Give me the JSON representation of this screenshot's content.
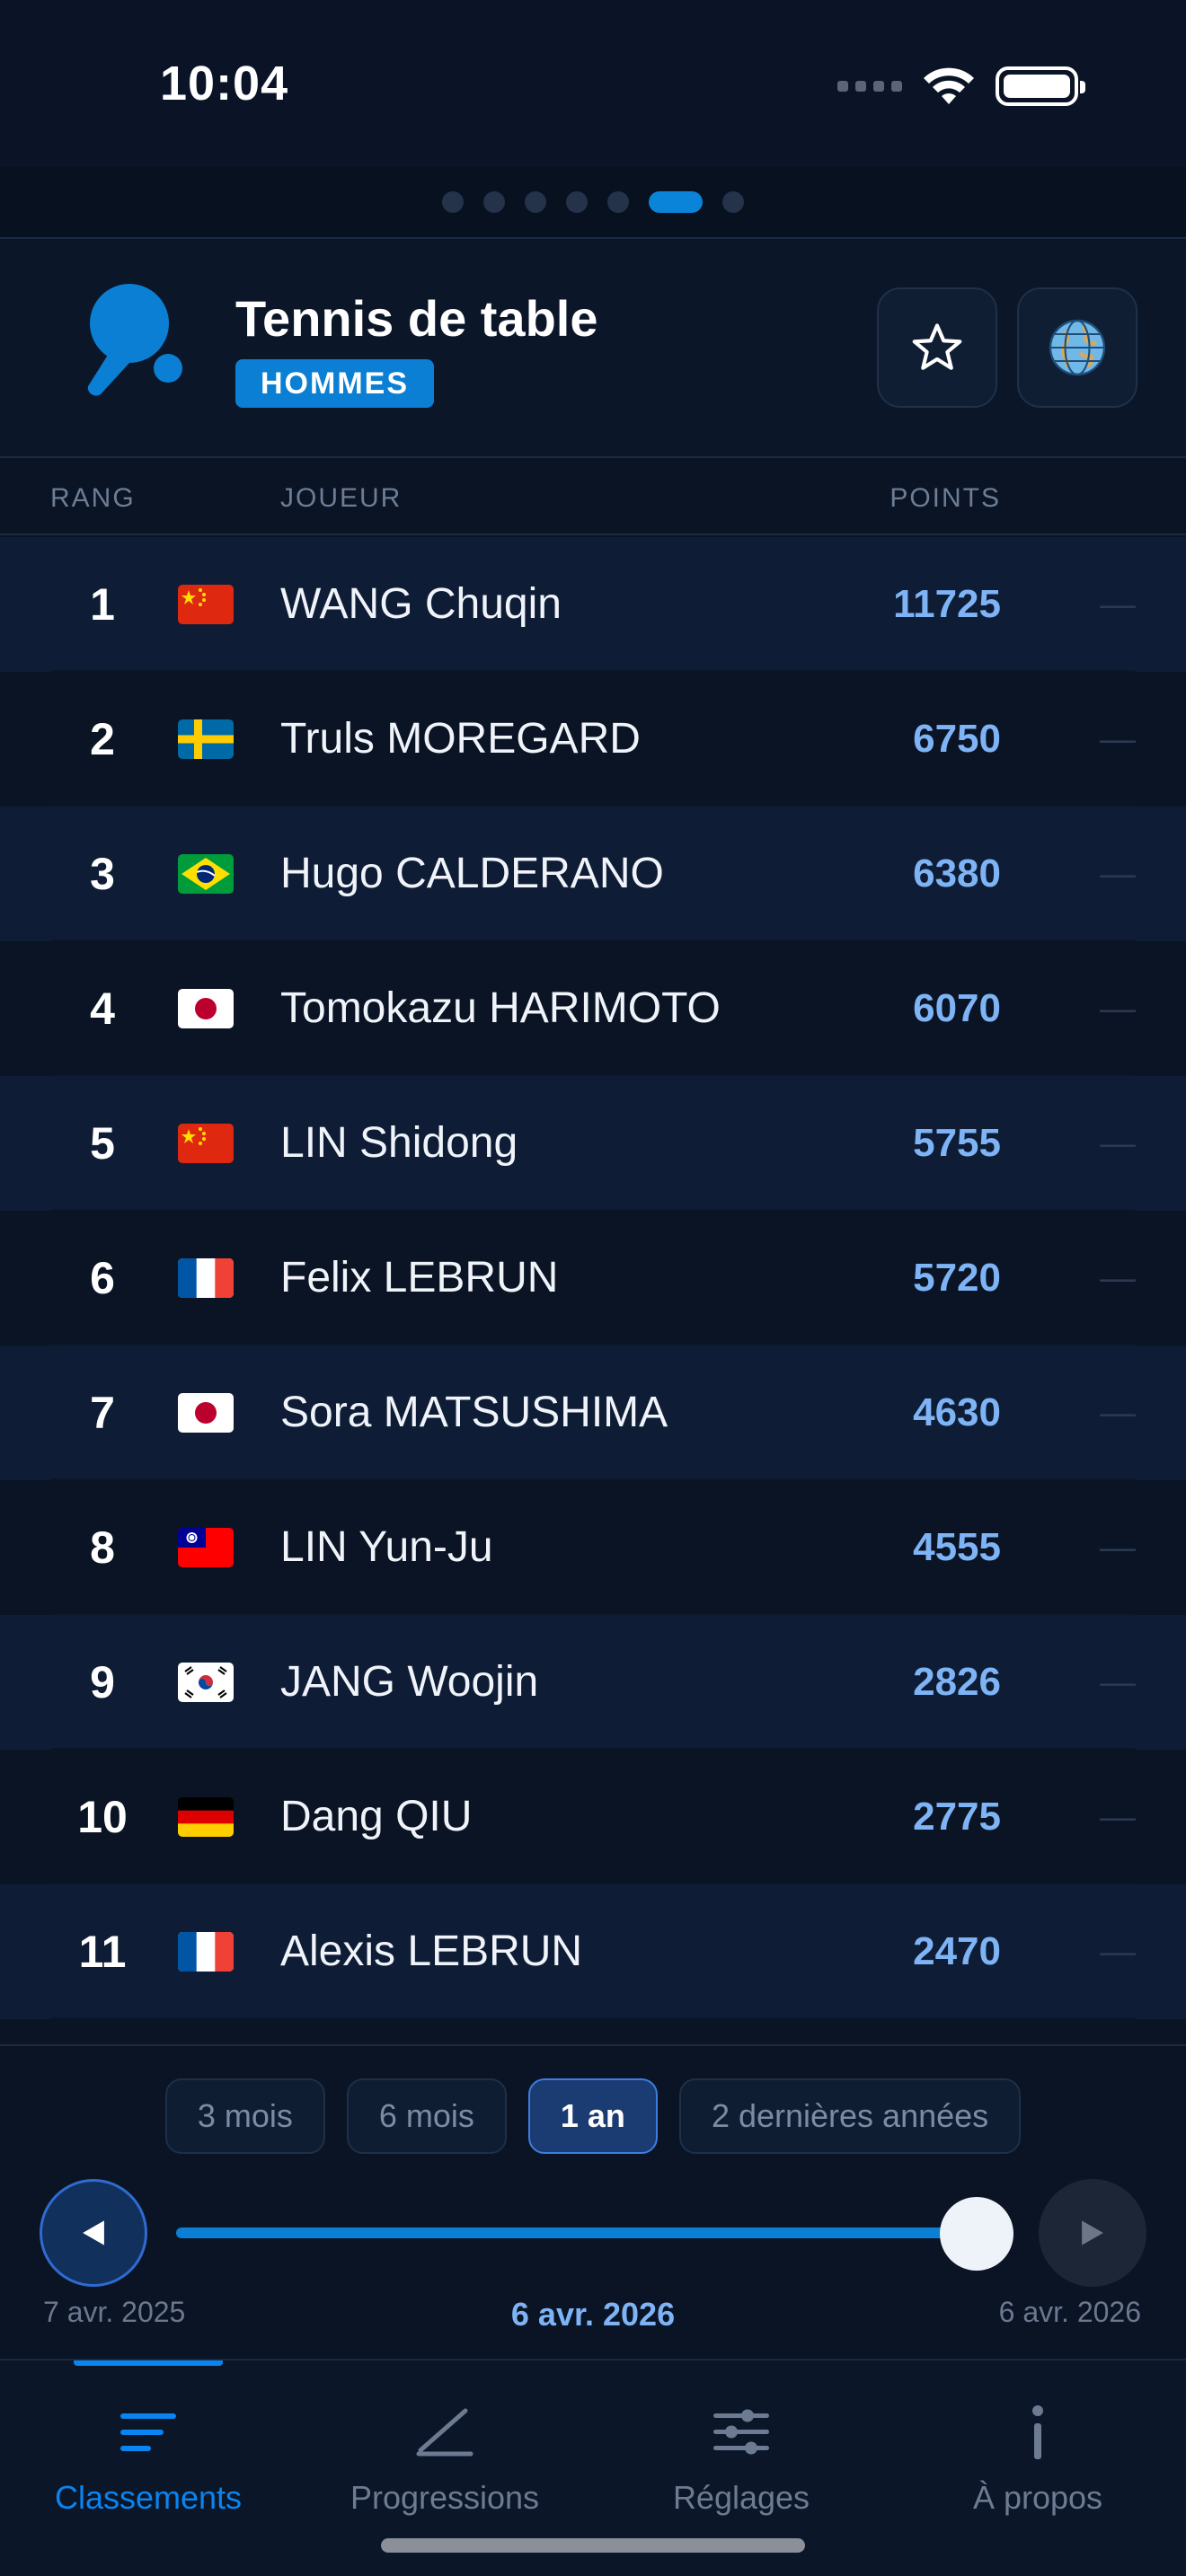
{
  "status_bar": {
    "time": "10:04"
  },
  "header": {
    "title": "Tennis de table",
    "badge": "HOMMES"
  },
  "table": {
    "columns": {
      "rank": "RANG",
      "player": "JOUEUR",
      "points": "POINTS"
    },
    "rows": [
      {
        "rank": "1",
        "flag": "china",
        "name": "WANG Chuqin",
        "points": "11725",
        "trend": "—"
      },
      {
        "rank": "2",
        "flag": "sweden",
        "name": "Truls MOREGARD",
        "points": "6750",
        "trend": "—"
      },
      {
        "rank": "3",
        "flag": "brazil",
        "name": "Hugo CALDERANO",
        "points": "6380",
        "trend": "—"
      },
      {
        "rank": "4",
        "flag": "japan",
        "name": "Tomokazu HARIMOTO",
        "points": "6070",
        "trend": "—"
      },
      {
        "rank": "5",
        "flag": "china",
        "name": "LIN Shidong",
        "points": "5755",
        "trend": "—"
      },
      {
        "rank": "6",
        "flag": "france",
        "name": "Felix LEBRUN",
        "points": "5720",
        "trend": "—"
      },
      {
        "rank": "7",
        "flag": "japan",
        "name": "Sora MATSUSHIMA",
        "points": "4630",
        "trend": "—"
      },
      {
        "rank": "8",
        "flag": "taiwan",
        "name": "LIN Yun-Ju",
        "points": "4555",
        "trend": "—"
      },
      {
        "rank": "9",
        "flag": "korea",
        "name": "JANG Woojin",
        "points": "2826",
        "trend": "—"
      },
      {
        "rank": "10",
        "flag": "germany",
        "name": "Dang QIU",
        "points": "2775",
        "trend": "—"
      },
      {
        "rank": "11",
        "flag": "france",
        "name": "Alexis LEBRUN",
        "points": "2470",
        "trend": "—"
      }
    ]
  },
  "period": {
    "options": [
      "3 mois",
      "6 mois",
      "1 an",
      "2 dernières années"
    ],
    "selected": "1 an",
    "slider_position": 1.0
  },
  "timeline": {
    "start": "7 avr. 2025",
    "current": "6 avr. 2026",
    "end": "6 avr. 2026"
  },
  "tabs": [
    {
      "label": "Classements",
      "icon": "list-icon",
      "active": true
    },
    {
      "label": "Progressions",
      "icon": "chart-line-icon",
      "active": false
    },
    {
      "label": "Réglages",
      "icon": "sliders-icon",
      "active": false
    },
    {
      "label": "À propos",
      "icon": "info-icon",
      "active": false
    }
  ],
  "colors": {
    "accent": "#0a84f0",
    "points": "#7eb4f5",
    "badge": "#0a7fd4",
    "background": "#0a1424"
  }
}
